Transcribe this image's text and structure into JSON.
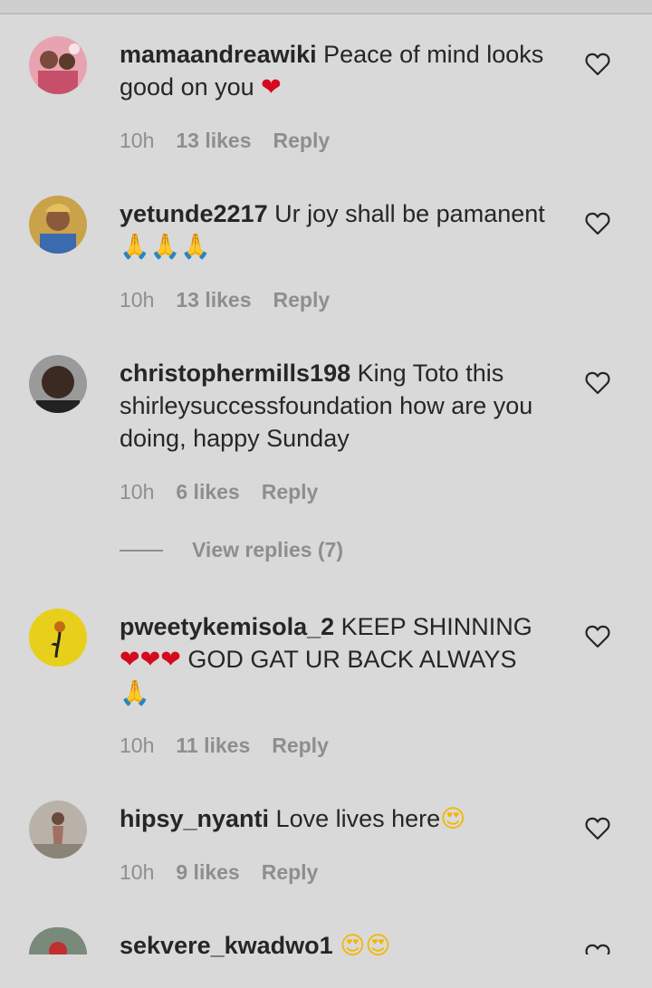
{
  "comments": [
    {
      "username": "mamaandreawiki",
      "text": " Peace of mind looks good on you ",
      "emoji": "❤",
      "time": "10h",
      "likes": "13 likes",
      "reply": "Reply"
    },
    {
      "username": "yetunde2217",
      "text": " Ur joy shall be pamanent",
      "emoji": "🙏🙏🙏",
      "time": "10h",
      "likes": "13 likes",
      "reply": "Reply"
    },
    {
      "username": "christophermills198",
      "text": " King Toto this shirleysuccessfoundation how are you doing, happy Sunday",
      "time": "10h",
      "likes": "6 likes",
      "reply": "Reply",
      "view_replies": "View replies (7)"
    },
    {
      "username": "pweetykemisola_2",
      "text": " KEEP SHINNING",
      "emoji_hearts": "❤❤❤",
      "text2": " GOD GAT UR BACK ALWAYS",
      "emoji_end": "🙏",
      "time": "10h",
      "likes": "11 likes",
      "reply": "Reply"
    },
    {
      "username": "hipsy_nyanti",
      "text": " Love lives here",
      "emoji": "😍",
      "time": "10h",
      "likes": "9 likes",
      "reply": "Reply"
    },
    {
      "username": "sekvere_kwadwo1",
      "emoji": "😍😍"
    }
  ],
  "icons": {
    "like": "heart-outline-icon"
  },
  "colors": {
    "background": "#d9d9d9",
    "text": "#262626",
    "muted": "#8e8e8e",
    "heart_emoji": "#d40b1c"
  }
}
